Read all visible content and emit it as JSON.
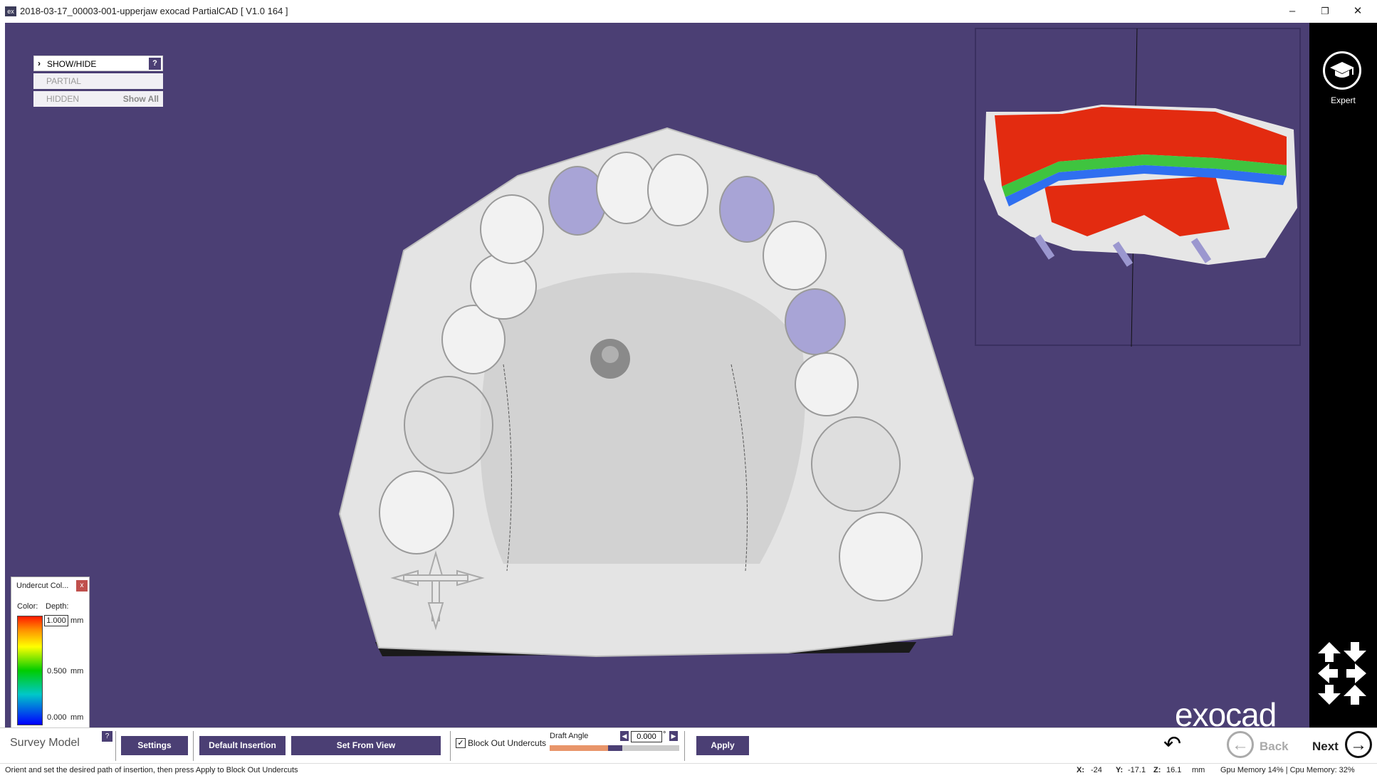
{
  "window": {
    "title": "2018-03-17_00003-001-upperjaw exocad PartialCAD [ V1.0 164 ]",
    "app_icon": "exocad-app-icon",
    "minimize": "–",
    "maximize": "❐",
    "close": "✕"
  },
  "show_hide": {
    "header": "SHOW/HIDE",
    "help": "?",
    "partial": "PARTIAL",
    "hidden": "HIDDEN",
    "show_all": "Show All"
  },
  "right_panel": {
    "expert_label": "Expert",
    "icons": [
      "graduation-cap-icon",
      "view-arrows-icon"
    ]
  },
  "legend": {
    "title": "Undercut Col...",
    "close": "x",
    "color_label": "Color:",
    "depth_label": "Depth:",
    "values": [
      "1.000",
      "0.500",
      "0.000"
    ],
    "unit": "mm",
    "gradient": [
      "#ff1a00",
      "#ffff00",
      "#00cc00",
      "#00c8c8",
      "#0000ff"
    ]
  },
  "brand": "exocad",
  "toolbar": {
    "survey_model": "Survey Model",
    "help": "?",
    "settings": "Settings",
    "default_insertion": "Default Insertion",
    "set_from_view": "Set From View",
    "block_out_checked": "✓",
    "block_out_undercuts": "Block Out Undercuts",
    "draft_angle_label": "Draft Angle",
    "draft_angle_value": "0.000",
    "degree": "°",
    "slider_level": 0.45,
    "apply": "Apply",
    "undo_icon": "↶",
    "back": "Back",
    "next": "Next"
  },
  "status": {
    "message": "Orient and set the desired path of insertion, then press Apply to Block Out Undercuts",
    "x_label": "X:",
    "x": "-24",
    "y_label": "Y:",
    "y": "-17.1",
    "z_label": "Z:",
    "z": "16.1",
    "unit": "mm",
    "memory": "Gpu Memory 14% | Cpu Memory: 32%"
  },
  "colors": {
    "viewport_bg": "#4b3f74",
    "button": "#4b3f74",
    "side_panel": "#000000"
  }
}
